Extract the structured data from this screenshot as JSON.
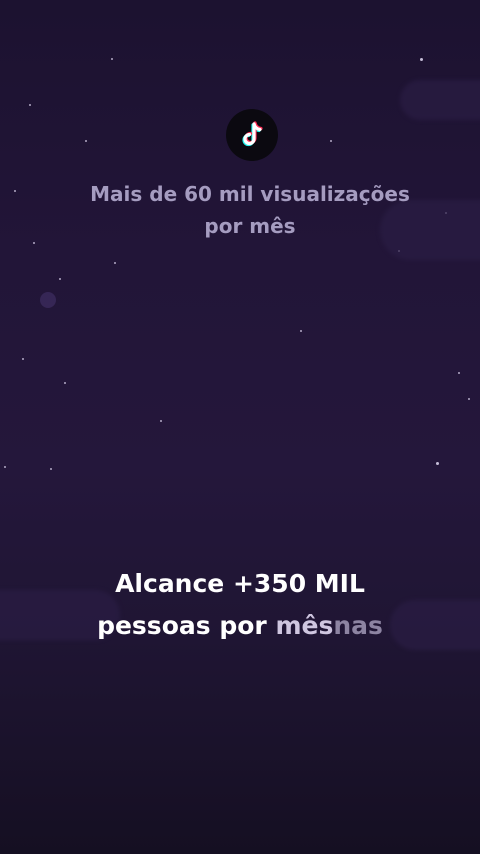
{
  "header": {
    "logo_icon": "tiktok-icon",
    "subtitle_line1": "Mais de 60 mil visualizações",
    "subtitle_line2": "por mês"
  },
  "caption": {
    "line1": "Alcance +350 MIL",
    "line2_a": "pessoas por",
    "line2_b": "mês",
    "line2_c": "nas"
  },
  "colors": {
    "background": "#221538",
    "subtitle_text": "#a59cc0",
    "caption_text": "#ffffff"
  }
}
